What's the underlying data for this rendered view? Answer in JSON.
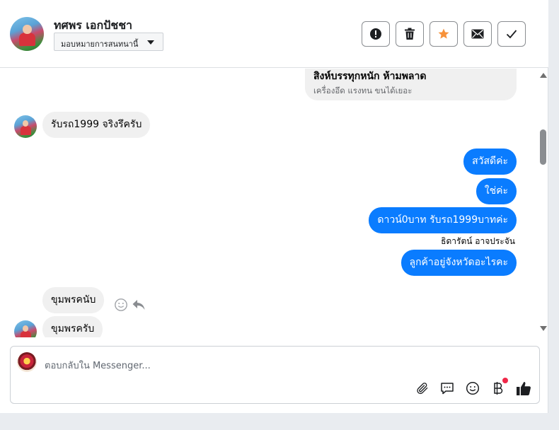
{
  "header": {
    "contact_name": "ทศพร เอกปัชชา",
    "assign_label": "มอบหมายการสนทนานี้",
    "actions": [
      {
        "name": "report-button",
        "icon": "exclamation-icon"
      },
      {
        "name": "delete-button",
        "icon": "trash-icon"
      },
      {
        "name": "star-button",
        "icon": "star-icon",
        "color": "#f7923a"
      },
      {
        "name": "mark-unread-button",
        "icon": "envelope-icon"
      },
      {
        "name": "mark-done-button",
        "icon": "check-icon"
      }
    ]
  },
  "thread": {
    "quoted_message": {
      "title": "สิงห์บรรทุกหนัก ห้ามพลาด",
      "subtitle": "เครื่องอึด แรงทน ขนได้เยอะ"
    },
    "messages": [
      {
        "direction": "in",
        "text": "รับรถ1999 จริงรึครับ"
      },
      {
        "direction": "out",
        "text": "สวัสดีค่ะ"
      },
      {
        "direction": "out",
        "text": "ใช่ค่ะ"
      },
      {
        "direction": "out",
        "text": "ดาวน์0บาท รับรถ1999บาทค่ะ"
      },
      {
        "direction": "out",
        "text": "ลูกค้าอยู่จังหวัดอะไรคะ"
      },
      {
        "direction": "in",
        "text": "ขุมพรคนับ"
      },
      {
        "direction": "in",
        "text": "ขุมพรครับ"
      }
    ],
    "sender_label": "ธิดารัตน์ อาจประจัน"
  },
  "composer": {
    "placeholder": "ตอบกลับใน Messenger...",
    "icons": [
      "paperclip-icon",
      "saved-reply-icon",
      "emoji-icon",
      "baht-payment-icon",
      "thumbs-up-icon"
    ],
    "notification_color": "#f02849"
  },
  "colors": {
    "outgoing_bubble": "#0a7cff",
    "incoming_bubble": "#f0f0f0"
  }
}
